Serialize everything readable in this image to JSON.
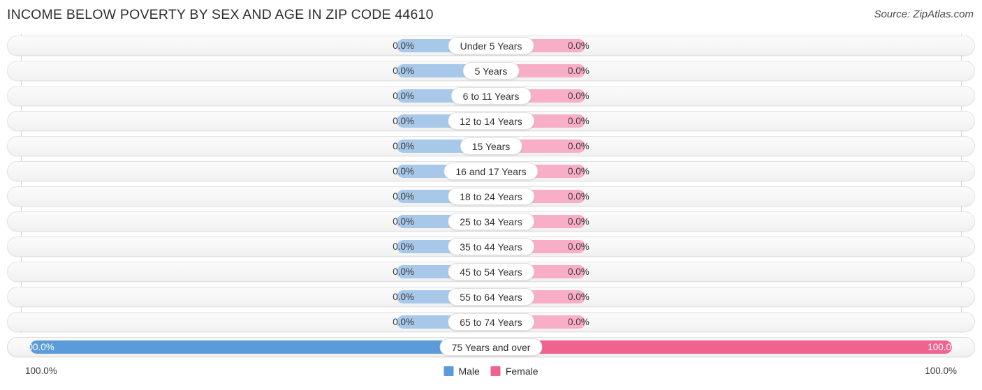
{
  "header": {
    "title": "INCOME BELOW POVERTY BY SEX AND AGE IN ZIP CODE 44610",
    "source": "Source: ZipAtlas.com"
  },
  "legend": {
    "male_label": "Male",
    "female_label": "Female",
    "male_color": "#5b9bd9",
    "female_color": "#f1638f"
  },
  "axis": {
    "left_label": "100.0%",
    "right_label": "100.0%"
  },
  "colors": {
    "male_zero": "#a8c8ea",
    "female_zero": "#f8aec6",
    "male_full": "#5b9bd9",
    "female_full": "#f1638f",
    "track": "#f6f6f6",
    "gridline": "#d7d7d7"
  },
  "chart_data": {
    "type": "bar",
    "subtype": "diverging-butterfly",
    "title": "INCOME BELOW POVERTY BY SEX AND AGE IN ZIP CODE 44610",
    "xlabel": "",
    "ylabel": "",
    "xlim": [
      0,
      100
    ],
    "grid": true,
    "legend_position": "bottom-center",
    "categories": [
      "Under 5 Years",
      "5 Years",
      "6 to 11 Years",
      "12 to 14 Years",
      "15 Years",
      "16 and 17 Years",
      "18 to 24 Years",
      "25 to 34 Years",
      "35 to 44 Years",
      "45 to 54 Years",
      "55 to 64 Years",
      "65 to 74 Years",
      "75 Years and over"
    ],
    "series": [
      {
        "name": "Male",
        "side": "left",
        "values": [
          0.0,
          0.0,
          0.0,
          0.0,
          0.0,
          0.0,
          0.0,
          0.0,
          0.0,
          0.0,
          0.0,
          0.0,
          100.0
        ],
        "labels": [
          "0.0%",
          "0.0%",
          "0.0%",
          "0.0%",
          "0.0%",
          "0.0%",
          "0.0%",
          "0.0%",
          "0.0%",
          "0.0%",
          "0.0%",
          "0.0%",
          "100.0%"
        ]
      },
      {
        "name": "Female",
        "side": "right",
        "values": [
          0.0,
          0.0,
          0.0,
          0.0,
          0.0,
          0.0,
          0.0,
          0.0,
          0.0,
          0.0,
          0.0,
          0.0,
          100.0
        ],
        "labels": [
          "0.0%",
          "0.0%",
          "0.0%",
          "0.0%",
          "0.0%",
          "0.0%",
          "0.0%",
          "0.0%",
          "0.0%",
          "0.0%",
          "0.0%",
          "0.0%",
          "100.0%"
        ]
      }
    ]
  }
}
